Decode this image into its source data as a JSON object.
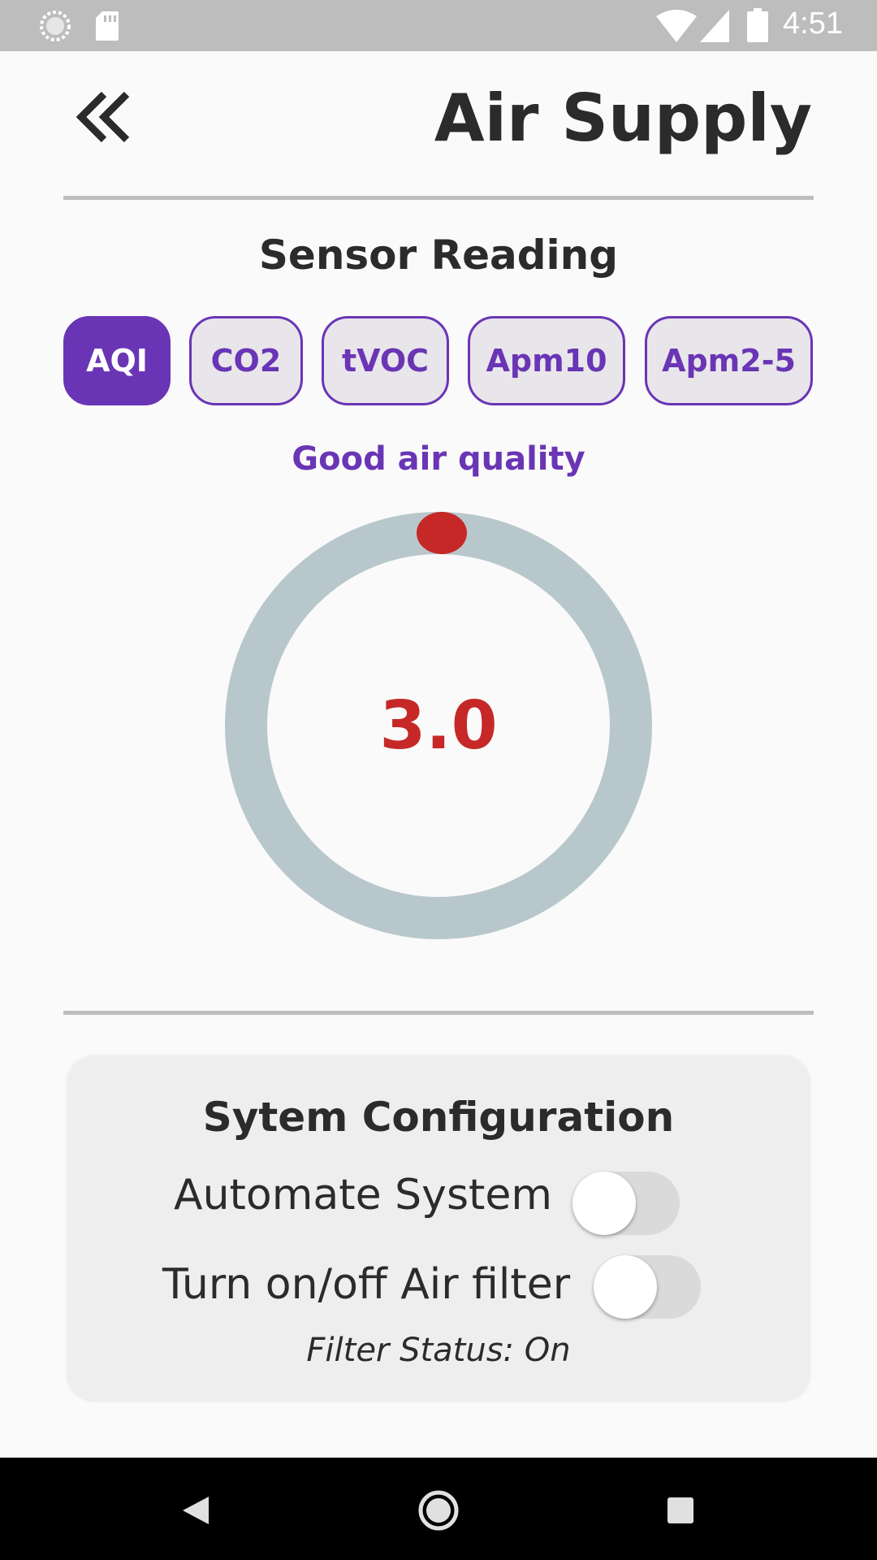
{
  "status_bar": {
    "time": "4:51",
    "icons": [
      "sync-icon",
      "sd-card-icon",
      "wifi-icon",
      "signal-icon",
      "battery-icon"
    ]
  },
  "header": {
    "title": "Air Supply",
    "back_icon": "double-chevron-left-icon"
  },
  "sensor": {
    "title": "Sensor Reading",
    "chips": [
      {
        "label": "AQI",
        "active": true
      },
      {
        "label": "CO2",
        "active": false
      },
      {
        "label": "tVOC",
        "active": false
      },
      {
        "label": "Apm10",
        "active": false
      },
      {
        "label": "Apm2-5",
        "active": false
      }
    ],
    "quality_text": "Good air quality",
    "gauge_value": "3.0"
  },
  "config": {
    "title": "Sytem Configuration",
    "automate_label": "Automate System",
    "automate_on": false,
    "filter_label": "Turn on/off Air filter",
    "filter_on": false,
    "filter_status": "Filter Status: On"
  },
  "nav_bar": {
    "buttons": [
      "back-triangle-icon",
      "home-circle-icon",
      "recent-square-icon"
    ]
  },
  "colors": {
    "accent": "#6a35b5",
    "value_red": "#c62828",
    "gauge_track": "#b8c7cc",
    "status_bar": "#bdbdbd"
  }
}
